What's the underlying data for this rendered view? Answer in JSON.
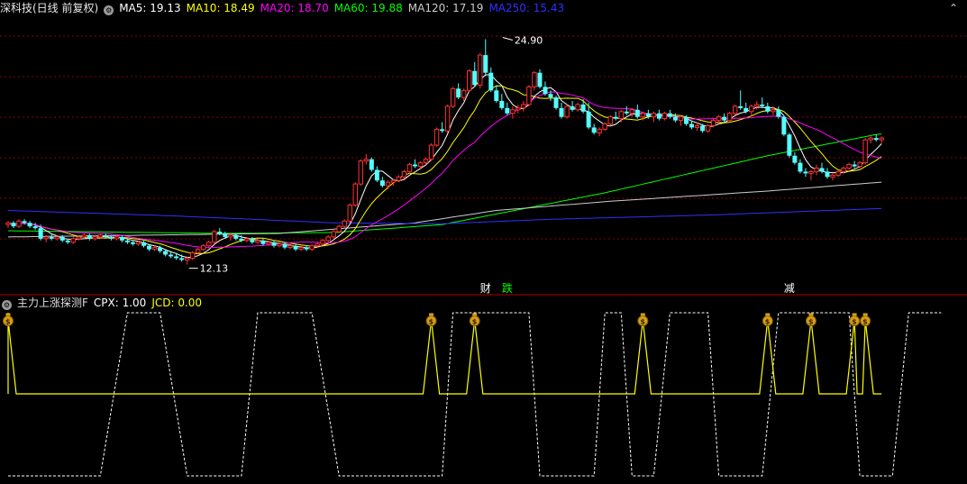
{
  "header": {
    "security": "深科技(日线 前复权)",
    "indicators": [
      {
        "label": "MA5: 19.13",
        "color": "#ffffff"
      },
      {
        "label": "MA10: 18.49",
        "color": "#ffff00"
      },
      {
        "label": "MA20: 18.70",
        "color": "#ff00ff"
      },
      {
        "label": "MA60: 19.88",
        "color": "#00ff00"
      },
      {
        "label": "MA120: 17.19",
        "color": "#cccccc"
      },
      {
        "label": "MA250: 15.43",
        "color": "#3030ff"
      }
    ]
  },
  "subheader": {
    "name": "主力上涨探测F",
    "cpx": "CPX: 1.00",
    "jcd": "JCD: 0.00",
    "cpx_color": "#ffffff",
    "jcd_color": "#ffff00"
  },
  "colors": {
    "up": "#ff3232",
    "down": "#54ffff",
    "grid": "#8b0000",
    "panel_border": "#b40000"
  },
  "chart_data": {
    "type": "candlestick",
    "y_range": [
      11.5,
      26.2
    ],
    "annotations": [
      {
        "label": "24.90",
        "index": 91,
        "value": 24.9,
        "kind": "high"
      },
      {
        "label": "12.13",
        "index": 33,
        "value": 12.13,
        "kind": "low"
      }
    ],
    "event_markers": [
      {
        "label": "财",
        "index": 88,
        "color": "#ffffff"
      },
      {
        "label": "跌",
        "index": 92,
        "color": "#00ff00"
      },
      {
        "label": "减",
        "index": 144,
        "color": "#ffffff"
      }
    ],
    "ohlc": [
      [
        14.4,
        14.6,
        14.2,
        14.5
      ],
      [
        14.5,
        14.6,
        14.2,
        14.3
      ],
      [
        14.3,
        14.7,
        14.2,
        14.6
      ],
      [
        14.6,
        14.7,
        14.4,
        14.5
      ],
      [
        14.5,
        14.6,
        14.2,
        14.3
      ],
      [
        14.3,
        14.5,
        14.1,
        14.2
      ],
      [
        14.2,
        14.4,
        13.5,
        13.6
      ],
      [
        13.6,
        13.8,
        13.4,
        13.7
      ],
      [
        13.7,
        13.9,
        13.5,
        13.6
      ],
      [
        13.6,
        13.8,
        13.5,
        13.7
      ],
      [
        13.7,
        13.8,
        13.4,
        13.5
      ],
      [
        13.5,
        13.6,
        13.3,
        13.4
      ],
      [
        13.4,
        13.7,
        13.3,
        13.6
      ],
      [
        13.6,
        13.8,
        13.5,
        13.7
      ],
      [
        13.7,
        13.9,
        13.6,
        13.8
      ],
      [
        13.8,
        13.9,
        13.5,
        13.6
      ],
      [
        13.6,
        13.8,
        13.5,
        13.7
      ],
      [
        13.7,
        13.9,
        13.6,
        13.8
      ],
      [
        13.8,
        13.9,
        13.6,
        13.7
      ],
      [
        13.7,
        13.8,
        13.5,
        13.6
      ],
      [
        13.6,
        13.8,
        13.5,
        13.7
      ],
      [
        13.7,
        13.8,
        13.4,
        13.5
      ],
      [
        13.5,
        13.6,
        13.3,
        13.4
      ],
      [
        13.4,
        13.5,
        13.2,
        13.3
      ],
      [
        13.3,
        13.5,
        13.2,
        13.4
      ],
      [
        13.4,
        13.5,
        13.1,
        13.2
      ],
      [
        13.2,
        13.3,
        12.9,
        13.0
      ],
      [
        13.0,
        13.2,
        12.9,
        13.1
      ],
      [
        13.1,
        13.2,
        12.8,
        12.9
      ],
      [
        12.9,
        13.0,
        12.6,
        12.7
      ],
      [
        12.7,
        12.9,
        12.5,
        12.6
      ],
      [
        12.6,
        12.8,
        12.4,
        12.5
      ],
      [
        12.5,
        12.7,
        12.3,
        12.4
      ],
      [
        12.4,
        12.6,
        12.13,
        12.5
      ],
      [
        12.5,
        12.9,
        12.4,
        12.8
      ],
      [
        12.8,
        13.1,
        12.7,
        13.0
      ],
      [
        13.0,
        13.3,
        12.9,
        13.2
      ],
      [
        13.2,
        13.5,
        13.1,
        13.4
      ],
      [
        13.4,
        14.1,
        13.3,
        14.0
      ],
      [
        14.0,
        14.2,
        13.8,
        13.9
      ],
      [
        13.9,
        14.0,
        13.6,
        13.7
      ],
      [
        13.7,
        13.9,
        13.5,
        13.8
      ],
      [
        13.8,
        13.9,
        13.5,
        13.6
      ],
      [
        13.6,
        13.8,
        13.4,
        13.5
      ],
      [
        13.5,
        13.7,
        13.4,
        13.6
      ],
      [
        13.6,
        13.7,
        13.3,
        13.4
      ],
      [
        13.4,
        13.6,
        13.3,
        13.5
      ],
      [
        13.5,
        13.6,
        13.2,
        13.3
      ],
      [
        13.3,
        13.5,
        13.2,
        13.4
      ],
      [
        13.4,
        13.5,
        13.1,
        13.2
      ],
      [
        13.2,
        13.4,
        13.1,
        13.3
      ],
      [
        13.3,
        13.4,
        13.0,
        13.1
      ],
      [
        13.1,
        13.3,
        13.0,
        13.2
      ],
      [
        13.2,
        13.3,
        12.9,
        13.0
      ],
      [
        13.0,
        13.2,
        12.9,
        13.1
      ],
      [
        13.1,
        13.2,
        12.9,
        13.0
      ],
      [
        13.0,
        13.3,
        12.9,
        13.2
      ],
      [
        13.2,
        13.4,
        13.1,
        13.3
      ],
      [
        13.3,
        13.6,
        13.2,
        13.5
      ],
      [
        13.5,
        13.8,
        13.4,
        13.7
      ],
      [
        13.7,
        14.1,
        13.6,
        14.0
      ],
      [
        14.0,
        14.4,
        13.9,
        14.3
      ],
      [
        14.3,
        14.7,
        14.2,
        14.6
      ],
      [
        14.6,
        15.6,
        14.5,
        15.5
      ],
      [
        15.5,
        16.8,
        15.4,
        16.7
      ],
      [
        16.7,
        18.1,
        16.6,
        18.0
      ],
      [
        18.0,
        18.4,
        17.8,
        18.1
      ],
      [
        18.1,
        18.2,
        17.4,
        17.5
      ],
      [
        17.5,
        17.7,
        16.8,
        16.9
      ],
      [
        16.9,
        17.1,
        16.5,
        16.6
      ],
      [
        16.6,
        16.9,
        16.4,
        16.8
      ],
      [
        16.8,
        17.0,
        16.6,
        16.9
      ],
      [
        16.9,
        17.2,
        16.8,
        17.1
      ],
      [
        17.1,
        17.5,
        17.0,
        17.4
      ],
      [
        17.4,
        17.9,
        17.3,
        17.8
      ],
      [
        17.8,
        18.1,
        17.6,
        17.7
      ],
      [
        17.7,
        18.0,
        17.5,
        17.9
      ],
      [
        17.9,
        18.2,
        17.8,
        18.1
      ],
      [
        18.1,
        19.0,
        18.0,
        18.9
      ],
      [
        18.9,
        19.9,
        18.8,
        19.8
      ],
      [
        19.8,
        20.2,
        19.6,
        19.7
      ],
      [
        19.7,
        21.2,
        19.6,
        21.1
      ],
      [
        21.1,
        22.2,
        21.0,
        22.1
      ],
      [
        22.1,
        22.4,
        21.5,
        21.6
      ],
      [
        21.6,
        22.1,
        21.4,
        22.0
      ],
      [
        22.0,
        23.2,
        21.9,
        23.1
      ],
      [
        23.1,
        23.6,
        22.2,
        22.3
      ],
      [
        22.3,
        24.1,
        22.1,
        24.0
      ],
      [
        24.0,
        24.9,
        22.8,
        23.0
      ],
      [
        23.0,
        23.3,
        21.9,
        22.0
      ],
      [
        22.0,
        22.3,
        21.3,
        21.4
      ],
      [
        21.4,
        21.8,
        20.9,
        21.0
      ],
      [
        21.0,
        21.3,
        20.6,
        20.7
      ],
      [
        20.7,
        21.1,
        20.4,
        20.9
      ],
      [
        20.9,
        21.2,
        20.7,
        21.0
      ],
      [
        21.0,
        21.4,
        20.8,
        21.2
      ],
      [
        21.2,
        22.3,
        21.1,
        22.2
      ],
      [
        22.2,
        23.1,
        22.0,
        23.0
      ],
      [
        23.0,
        23.2,
        22.1,
        22.2
      ],
      [
        22.2,
        22.5,
        21.7,
        21.8
      ],
      [
        21.8,
        22.0,
        21.4,
        21.6
      ],
      [
        21.6,
        21.7,
        20.9,
        21.0
      ],
      [
        21.0,
        21.3,
        20.4,
        20.5
      ],
      [
        20.5,
        21.2,
        20.4,
        21.1
      ],
      [
        21.1,
        21.4,
        20.8,
        20.9
      ],
      [
        20.9,
        21.3,
        20.8,
        21.2
      ],
      [
        21.2,
        21.5,
        20.7,
        20.8
      ],
      [
        20.8,
        21.3,
        19.8,
        19.9
      ],
      [
        19.9,
        20.1,
        19.5,
        19.6
      ],
      [
        19.6,
        19.9,
        19.4,
        19.8
      ],
      [
        19.8,
        20.2,
        19.7,
        20.1
      ],
      [
        20.1,
        20.6,
        20.0,
        20.5
      ],
      [
        20.5,
        20.8,
        20.3,
        20.4
      ],
      [
        20.4,
        20.9,
        20.2,
        20.8
      ],
      [
        20.8,
        21.1,
        20.6,
        20.7
      ],
      [
        20.7,
        21.0,
        20.5,
        20.9
      ],
      [
        20.9,
        21.2,
        20.4,
        20.5
      ],
      [
        20.5,
        20.8,
        20.3,
        20.7
      ],
      [
        20.7,
        20.9,
        20.4,
        20.5
      ],
      [
        20.5,
        20.8,
        20.2,
        20.7
      ],
      [
        20.7,
        20.9,
        20.3,
        20.4
      ],
      [
        20.4,
        20.8,
        20.3,
        20.7
      ],
      [
        20.7,
        20.9,
        20.4,
        20.5
      ],
      [
        20.5,
        20.7,
        20.2,
        20.3
      ],
      [
        20.3,
        20.6,
        20.0,
        20.5
      ],
      [
        20.5,
        20.6,
        20.0,
        20.1
      ],
      [
        20.1,
        20.3,
        19.8,
        19.9
      ],
      [
        19.9,
        20.2,
        19.7,
        20.0
      ],
      [
        20.0,
        20.1,
        19.6,
        19.7
      ],
      [
        19.7,
        20.1,
        19.6,
        20.0
      ],
      [
        20.0,
        20.4,
        19.9,
        20.3
      ],
      [
        20.3,
        20.6,
        20.1,
        20.5
      ],
      [
        20.5,
        20.7,
        20.2,
        20.3
      ],
      [
        20.3,
        20.8,
        20.2,
        20.7
      ],
      [
        20.7,
        21.2,
        20.6,
        21.1
      ],
      [
        21.1,
        22.0,
        20.9,
        21.0
      ],
      [
        21.0,
        21.3,
        20.7,
        20.8
      ],
      [
        20.8,
        21.2,
        20.6,
        21.1
      ],
      [
        21.1,
        21.4,
        20.9,
        21.2
      ],
      [
        21.2,
        21.6,
        21.0,
        21.1
      ],
      [
        21.1,
        21.3,
        20.7,
        20.8
      ],
      [
        20.8,
        21.1,
        20.6,
        20.9
      ],
      [
        20.9,
        21.1,
        20.4,
        20.5
      ],
      [
        20.5,
        20.6,
        19.4,
        19.5
      ],
      [
        19.5,
        19.6,
        18.2,
        18.3
      ],
      [
        18.3,
        18.5,
        17.8,
        17.9
      ],
      [
        17.9,
        18.1,
        17.3,
        17.4
      ],
      [
        17.4,
        17.6,
        17.1,
        17.3
      ],
      [
        17.3,
        17.5,
        16.9,
        17.4
      ],
      [
        17.4,
        17.8,
        17.2,
        17.6
      ],
      [
        17.6,
        17.9,
        17.3,
        17.4
      ],
      [
        17.4,
        17.6,
        17.0,
        17.1
      ],
      [
        17.1,
        17.3,
        16.9,
        17.2
      ],
      [
        17.2,
        17.5,
        17.1,
        17.4
      ],
      [
        17.4,
        17.7,
        17.3,
        17.6
      ],
      [
        17.6,
        17.9,
        17.5,
        17.8
      ],
      [
        17.8,
        18.0,
        17.6,
        17.7
      ],
      [
        17.7,
        18.0,
        17.6,
        17.9
      ],
      [
        17.9,
        19.3,
        17.8,
        19.2
      ],
      [
        19.2,
        19.4,
        19.0,
        19.3
      ],
      [
        19.3,
        19.5,
        19.1,
        19.2
      ],
      [
        19.2,
        19.4,
        19.0,
        19.3
      ]
    ],
    "ma_series": [
      {
        "name": "MA5",
        "color": "#ffffff",
        "period": 5
      },
      {
        "name": "MA10",
        "color": "#ffff00",
        "period": 10
      },
      {
        "name": "MA20",
        "color": "#ff00ff",
        "period": 20
      },
      {
        "name": "MA60",
        "color": "#00ff00",
        "period": 60
      },
      {
        "name": "MA120",
        "color": "#cccccc",
        "period": 120
      },
      {
        "name": "MA250",
        "color": "#3030ff",
        "period": 250
      }
    ],
    "long_ma_keypoints": {
      "MA60": [
        [
          0,
          14.05
        ],
        [
          40,
          13.9
        ],
        [
          60,
          13.95
        ],
        [
          80,
          14.4
        ],
        [
          110,
          16.2
        ],
        [
          140,
          18.3
        ],
        [
          160,
          19.5
        ],
        [
          172,
          19.88
        ]
      ],
      "MA120": [
        [
          0,
          13.7
        ],
        [
          50,
          13.9
        ],
        [
          75,
          14.5
        ],
        [
          90,
          15.2
        ],
        [
          110,
          15.7
        ],
        [
          140,
          16.3
        ],
        [
          165,
          16.9
        ],
        [
          172,
          17.19
        ]
      ],
      "MA250": [
        [
          0,
          15.2
        ],
        [
          30,
          14.9
        ],
        [
          60,
          14.5
        ],
        [
          80,
          14.45
        ],
        [
          100,
          14.7
        ],
        [
          130,
          14.95
        ],
        [
          160,
          15.3
        ],
        [
          172,
          15.43
        ]
      ]
    },
    "sub_indicator": {
      "name": "主力上涨探测F",
      "series": [
        {
          "name": "CPX",
          "color": "#ffffff",
          "style": "dashed",
          "range": [
            0,
            1
          ],
          "segments": [
            [
              0,
              0
            ],
            [
              17,
              0
            ],
            [
              22,
              1
            ],
            [
              28,
              1
            ],
            [
              33,
              0
            ],
            [
              43,
              0
            ],
            [
              46,
              1
            ],
            [
              56,
              1
            ],
            [
              61,
              0
            ],
            [
              80,
              0
            ],
            [
              82,
              1
            ],
            [
              96,
              1
            ],
            [
              98,
              0
            ],
            [
              108,
              0
            ],
            [
              110,
              1
            ],
            [
              113,
              1
            ],
            [
              115,
              0
            ],
            [
              119,
              0
            ],
            [
              122,
              1
            ],
            [
              129,
              1
            ],
            [
              131,
              0
            ],
            [
              139,
              0
            ],
            [
              142,
              1
            ],
            [
              155,
              1
            ],
            [
              157,
              0
            ],
            [
              163,
              0
            ],
            [
              166,
              1
            ],
            [
              172,
              1
            ]
          ]
        },
        {
          "name": "JCD",
          "color": "#ffff00",
          "style": "solid",
          "range": [
            0,
            1
          ],
          "signals": [
            0,
            78,
            86,
            117,
            140,
            148,
            156,
            158
          ]
        }
      ]
    }
  }
}
